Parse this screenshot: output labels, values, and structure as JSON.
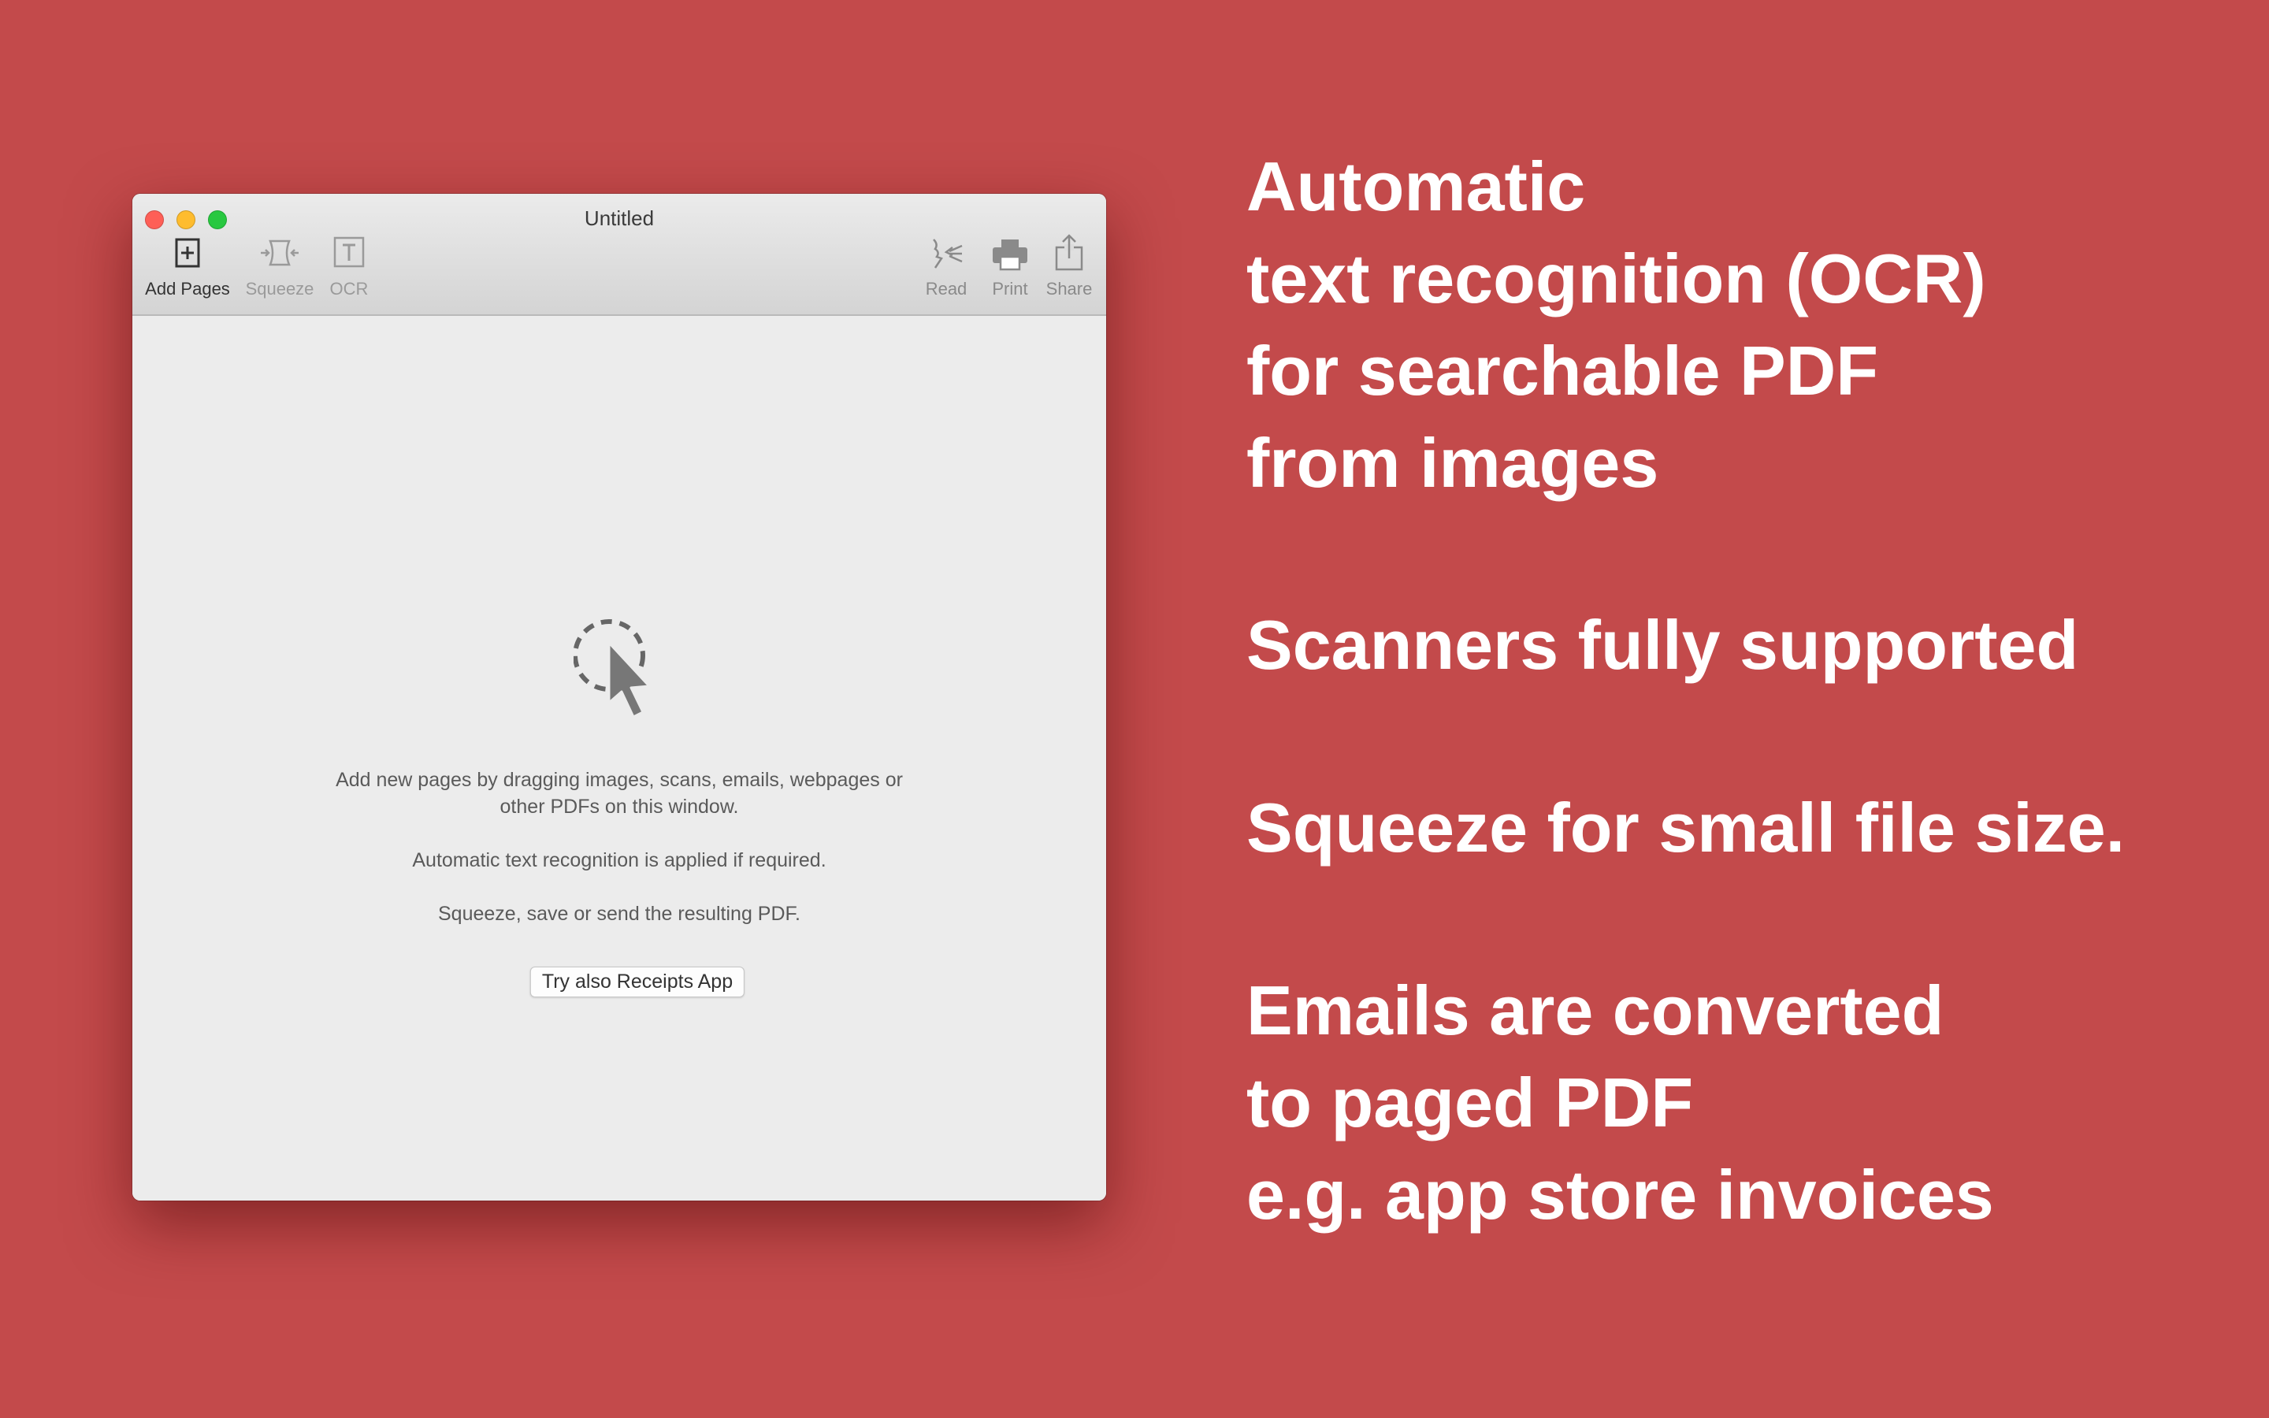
{
  "colors": {
    "background": "#c34a4b",
    "feature_text": "#ffffff",
    "close": "#fe5f57",
    "minimize": "#febc2e",
    "zoom": "#28c840",
    "toolbar_active": "#333333",
    "toolbar_inactive": "#9a9a9a",
    "toolbar_right": "#8a8a8a"
  },
  "window": {
    "title": "Untitled",
    "toolbar": {
      "add_pages": {
        "label": "Add Pages",
        "icon": "add-page-icon"
      },
      "squeeze": {
        "label": "Squeeze",
        "icon": "squeeze-icon"
      },
      "ocr": {
        "label": "OCR",
        "icon": "ocr-icon"
      },
      "read": {
        "label": "Read",
        "icon": "read-aloud-icon"
      },
      "print": {
        "label": "Print",
        "icon": "printer-icon"
      },
      "share": {
        "label": "Share",
        "icon": "share-icon"
      }
    },
    "content": {
      "drop_icon": "drag-cursor-icon",
      "message_line1": "Add new pages by dragging images, scans, emails, webpages or",
      "message_line2": "other PDFs on this window.",
      "ocr_note": "Automatic text recognition is applied if required.",
      "squeeze_note": "Squeeze, save or send the resulting PDF.",
      "receipts_button": "Try also Receipts App"
    }
  },
  "features": [
    {
      "lines": [
        "Automatic",
        "text recognition (OCR)",
        "for searchable PDF",
        "from images"
      ]
    },
    {
      "lines": [
        "Scanners fully supported"
      ]
    },
    {
      "lines": [
        "Squeeze for small file size."
      ]
    },
    {
      "lines": [
        "Emails are converted",
        "to paged PDF",
        "e.g. app store invoices"
      ]
    }
  ]
}
